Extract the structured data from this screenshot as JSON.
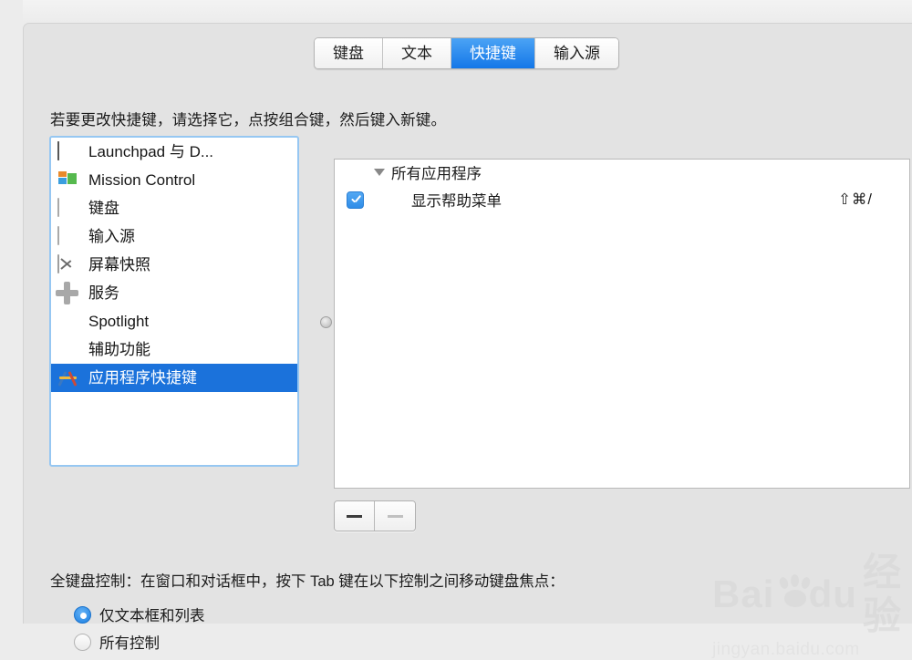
{
  "window": {
    "tabs": [
      {
        "label": "键盘",
        "name": "tab-keyboard",
        "active": false
      },
      {
        "label": "文本",
        "name": "tab-text",
        "active": false
      },
      {
        "label": "快捷键",
        "name": "tab-shortcuts",
        "active": true
      },
      {
        "label": "输入源",
        "name": "tab-input-sources",
        "active": false
      }
    ],
    "instruction": "若要更改快捷键，请选择它，点按组合键，然后键入新键。"
  },
  "sidebar": {
    "items": [
      {
        "label": "Launchpad 与 D...",
        "icon": "launchpad-dock-icon",
        "selected": false
      },
      {
        "label": "Mission Control",
        "icon": "mission-control-icon",
        "selected": false
      },
      {
        "label": "键盘",
        "icon": "keyboard-icon",
        "selected": false
      },
      {
        "label": "输入源",
        "icon": "input-source-icon",
        "selected": false
      },
      {
        "label": "屏幕快照",
        "icon": "screenshot-icon",
        "selected": false
      },
      {
        "label": "服务",
        "icon": "services-gear-icon",
        "selected": false
      },
      {
        "label": "Spotlight",
        "icon": "spotlight-icon",
        "selected": false
      },
      {
        "label": "辅助功能",
        "icon": "accessibility-icon",
        "selected": false
      },
      {
        "label": "应用程序快捷键",
        "icon": "app-shortcuts-icon",
        "selected": true
      }
    ]
  },
  "shortcut_list": {
    "group_label": "所有应用程序",
    "rows": [
      {
        "checked": true,
        "name": "显示帮助菜单",
        "key": "⇧⌘/"
      }
    ]
  },
  "list_buttons": {
    "add_label": "+",
    "remove_label": "–"
  },
  "bottom": {
    "full_keyboard_label": "全键盘控制：在窗口和对话框中，按下 Tab 键在以下控制之间移动键盘焦点：",
    "options": [
      {
        "label": "仅文本框和列表",
        "selected": true
      },
      {
        "label": "所有控制",
        "selected": false
      }
    ]
  },
  "watermark": {
    "main": "Bai",
    "main2": "du",
    "main3": "经验",
    "sub": "jingyan.baidu.com"
  },
  "colors": {
    "accent_blue": "#1b72db",
    "tab_active_blue": "#1477e8",
    "checkbox_blue": "#2f8de8",
    "window_bg": "#e3e3e3",
    "desktop_bg": "#ececec"
  }
}
